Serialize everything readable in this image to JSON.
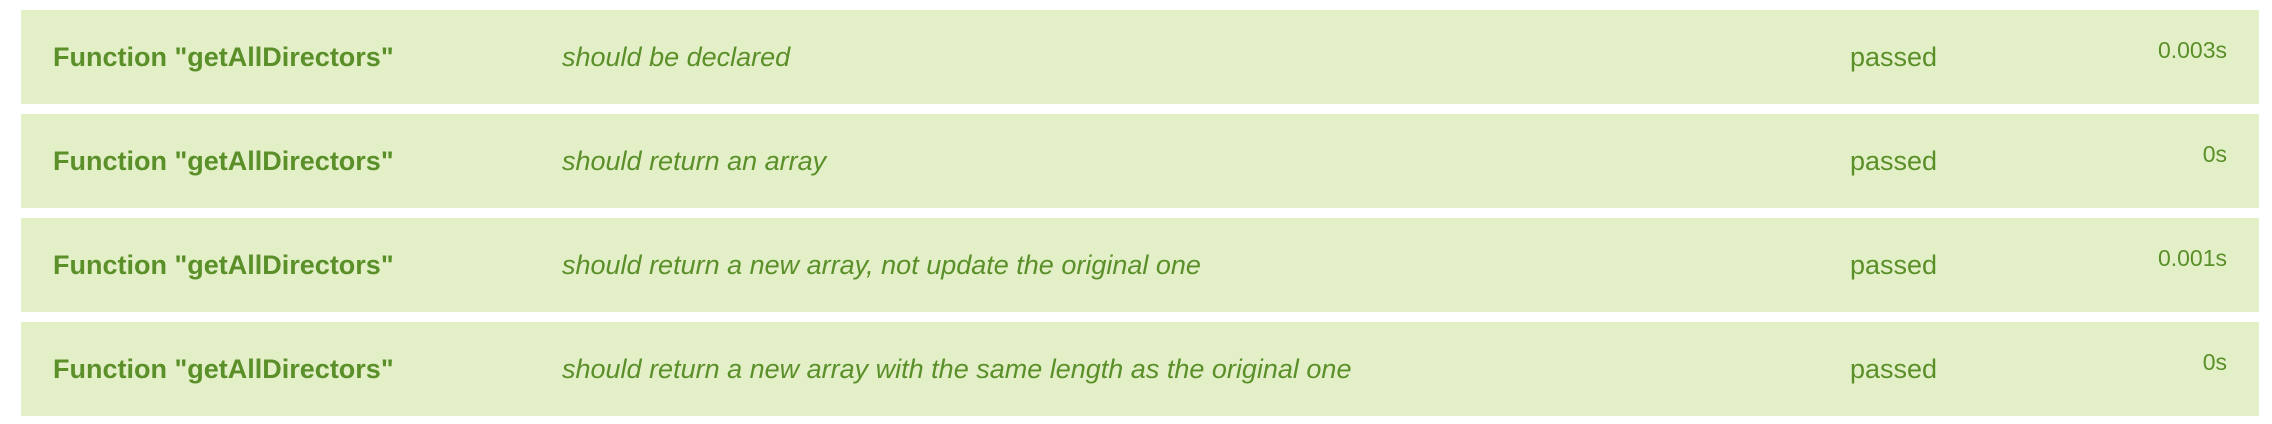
{
  "results": [
    {
      "suite": "Function \"getAllDirectors\"",
      "title": "should be declared",
      "status": "passed",
      "duration": "0.003s"
    },
    {
      "suite": "Function \"getAllDirectors\"",
      "title": "should return an array",
      "status": "passed",
      "duration": "0s"
    },
    {
      "suite": "Function \"getAllDirectors\"",
      "title": "should return a new array, not update the original one",
      "status": "passed",
      "duration": "0.001s"
    },
    {
      "suite": "Function \"getAllDirectors\"",
      "title": "should return a new array with the same length as the original one",
      "status": "passed",
      "duration": "0s"
    }
  ],
  "colors": {
    "row_background": "#e3f0c7",
    "text": "#5a8f29"
  }
}
